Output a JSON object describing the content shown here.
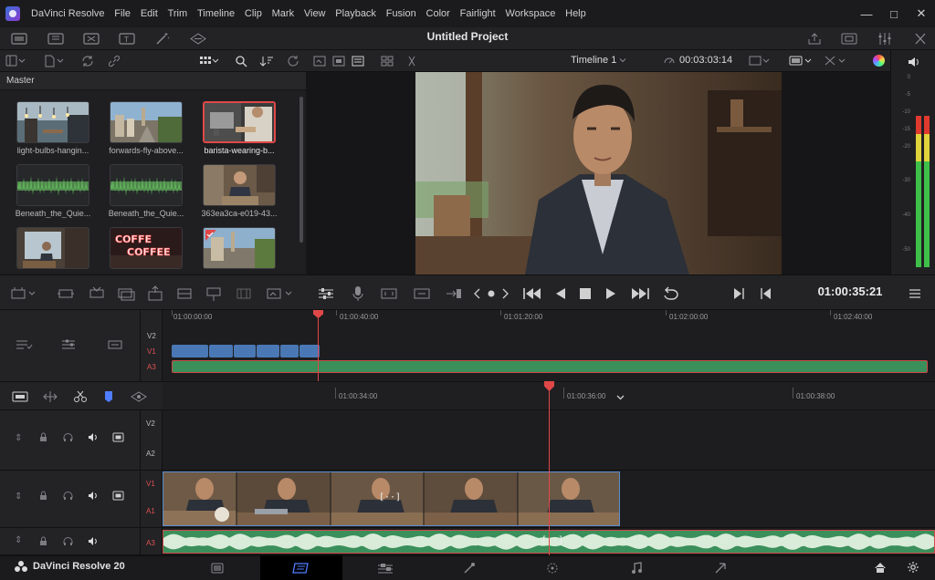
{
  "app": {
    "name": "DaVinci Resolve",
    "brand": "DaVinci Resolve 20"
  },
  "menu": [
    "DaVinci Resolve",
    "File",
    "Edit",
    "Trim",
    "Timeline",
    "Clip",
    "Mark",
    "View",
    "Playback",
    "Fusion",
    "Color",
    "Fairlight",
    "Workspace",
    "Help"
  ],
  "project": {
    "title": "Untitled Project"
  },
  "media_pool": {
    "header": "Master",
    "clips": [
      {
        "label": "light-bulbs-hangin...",
        "kind": "cafe-lights",
        "selected": false
      },
      {
        "label": "forwards-fly-above...",
        "kind": "street-aerial",
        "selected": false
      },
      {
        "label": "barista-wearing-b...",
        "kind": "barista",
        "selected": true
      },
      {
        "label": "Beneath_the_Quie...",
        "kind": "audio",
        "selected": false
      },
      {
        "label": "Beneath_the_Quie...",
        "kind": "audio",
        "selected": false
      },
      {
        "label": "363ea3ca-e019-43...",
        "kind": "man-laptop",
        "selected": false
      },
      {
        "label": "",
        "kind": "man-window",
        "selected": false
      },
      {
        "label": "",
        "kind": "coffee-sign",
        "selected": false
      },
      {
        "label": "",
        "kind": "street-day",
        "selected": false
      }
    ]
  },
  "viewer": {
    "timeline_name": "Timeline 1",
    "duration": "00:03:03:14",
    "timecode": "01:00:35:21"
  },
  "meters": {
    "scale": [
      "0",
      "-5",
      "-10",
      "-15",
      "-20",
      "-30",
      "-40",
      "-50"
    ],
    "levels": {
      "left": 0.8,
      "right": 0.8
    }
  },
  "upper_timeline": {
    "ruler": [
      "01:00:00:00",
      "01:00:40:00",
      "01:01:20:00",
      "01:02:00:00",
      "01:02:40:00"
    ],
    "tracks": [
      "V2",
      "V1",
      "A3"
    ]
  },
  "lower_timeline": {
    "ruler": [
      "01:00:34:00",
      "01:00:36:00",
      "01:00:38:00"
    ],
    "tracks": [
      "V2",
      "A2",
      "V1",
      "A1",
      "A3"
    ]
  },
  "colors": {
    "accent_red": "#e04848",
    "video_clip": "#4a78b4",
    "audio_clip": "#3a8f5a",
    "active_page": "#4f7dff"
  },
  "icons": {
    "pages": [
      "media-page-icon",
      "cut-page-icon",
      "edit-page-icon",
      "fusion-page-icon",
      "color-page-icon",
      "fairlight-page-icon",
      "deliver-page-icon"
    ]
  }
}
